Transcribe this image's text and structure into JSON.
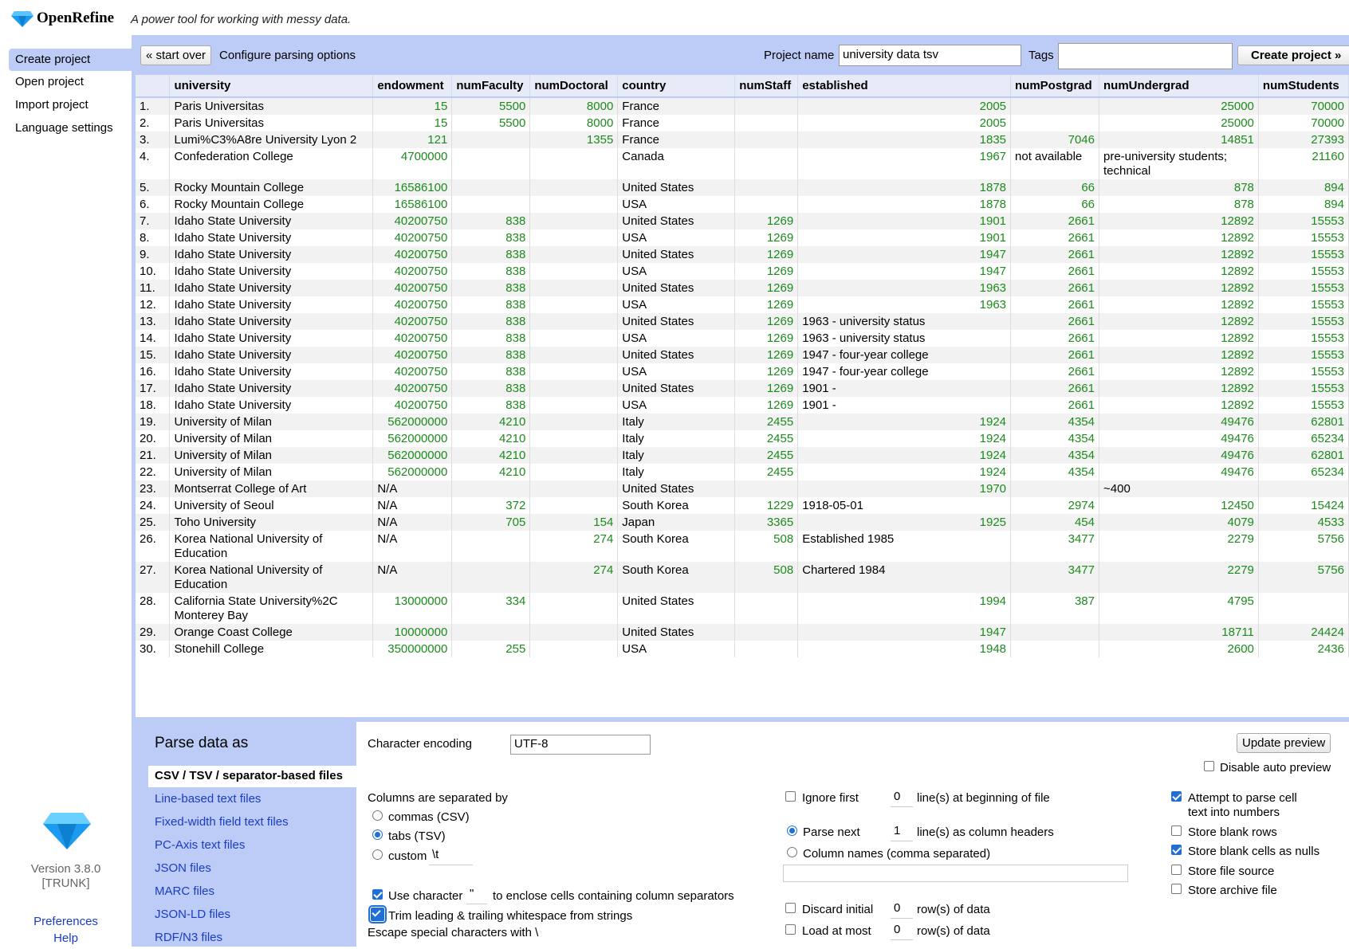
{
  "app": {
    "name": "OpenRefine",
    "tagline": "A power tool for working with messy data."
  },
  "nav": {
    "items": [
      "Create project",
      "Open project",
      "Import project",
      "Language settings"
    ],
    "version": "Version 3.8.0",
    "trunk": "[TRUNK]",
    "preferences": "Preferences",
    "help": "Help"
  },
  "toolbar": {
    "start_over": "« start over",
    "configure": "Configure parsing options",
    "project_name_label": "Project name",
    "project_name_value": "university data tsv",
    "tags_label": "Tags",
    "tags_value": "",
    "create_project": "Create project »"
  },
  "table": {
    "columns": [
      "",
      "university",
      "endowment",
      "numFaculty",
      "numDoctoral",
      "country",
      "numStaff",
      "established",
      "numPostgrad",
      "numUndergrad",
      "numStudents"
    ],
    "rows": [
      [
        "1.",
        "Paris Universitas",
        "15",
        "5500",
        "8000",
        "France",
        "",
        "2005",
        "",
        "25000",
        "70000"
      ],
      [
        "2.",
        "Paris Universitas",
        "15",
        "5500",
        "8000",
        "France",
        "",
        "2005",
        "",
        "25000",
        "70000"
      ],
      [
        "3.",
        "Lumi%C3%A8re University Lyon 2",
        "121",
        "",
        "1355",
        "France",
        "",
        "1835",
        "7046",
        "14851",
        "27393"
      ],
      [
        "4.",
        "Confederation College",
        "4700000",
        "",
        "",
        "Canada",
        "",
        "1967",
        "not available",
        "pre-university students; technical",
        "21160"
      ],
      [
        "5.",
        "Rocky Mountain College",
        "16586100",
        "",
        "",
        "United States",
        "",
        "1878",
        "66",
        "878",
        "894"
      ],
      [
        "6.",
        "Rocky Mountain College",
        "16586100",
        "",
        "",
        "USA",
        "",
        "1878",
        "66",
        "878",
        "894"
      ],
      [
        "7.",
        "Idaho State University",
        "40200750",
        "838",
        "",
        "United States",
        "1269",
        "1901",
        "2661",
        "12892",
        "15553"
      ],
      [
        "8.",
        "Idaho State University",
        "40200750",
        "838",
        "",
        "USA",
        "1269",
        "1901",
        "2661",
        "12892",
        "15553"
      ],
      [
        "9.",
        "Idaho State University",
        "40200750",
        "838",
        "",
        "United States",
        "1269",
        "1947",
        "2661",
        "12892",
        "15553"
      ],
      [
        "10.",
        "Idaho State University",
        "40200750",
        "838",
        "",
        "USA",
        "1269",
        "1947",
        "2661",
        "12892",
        "15553"
      ],
      [
        "11.",
        "Idaho State University",
        "40200750",
        "838",
        "",
        "United States",
        "1269",
        "1963",
        "2661",
        "12892",
        "15553"
      ],
      [
        "12.",
        "Idaho State University",
        "40200750",
        "838",
        "",
        "USA",
        "1269",
        "1963",
        "2661",
        "12892",
        "15553"
      ],
      [
        "13.",
        "Idaho State University",
        "40200750",
        "838",
        "",
        "United States",
        "1269",
        "1963 - university status",
        "2661",
        "12892",
        "15553"
      ],
      [
        "14.",
        "Idaho State University",
        "40200750",
        "838",
        "",
        "USA",
        "1269",
        "1963 - university status",
        "2661",
        "12892",
        "15553"
      ],
      [
        "15.",
        "Idaho State University",
        "40200750",
        "838",
        "",
        "United States",
        "1269",
        "1947 - four-year college",
        "2661",
        "12892",
        "15553"
      ],
      [
        "16.",
        "Idaho State University",
        "40200750",
        "838",
        "",
        "USA",
        "1269",
        "1947 - four-year college",
        "2661",
        "12892",
        "15553"
      ],
      [
        "17.",
        "Idaho State University",
        "40200750",
        "838",
        "",
        "United States",
        "1269",
        "1901 -",
        "2661",
        "12892",
        "15553"
      ],
      [
        "18.",
        "Idaho State University",
        "40200750",
        "838",
        "",
        "USA",
        "1269",
        "1901 -",
        "2661",
        "12892",
        "15553"
      ],
      [
        "19.",
        "University of Milan",
        "562000000",
        "4210",
        "",
        "Italy",
        "2455",
        "1924",
        "4354",
        "49476",
        "62801"
      ],
      [
        "20.",
        "University of Milan",
        "562000000",
        "4210",
        "",
        "Italy",
        "2455",
        "1924",
        "4354",
        "49476",
        "65234"
      ],
      [
        "21.",
        "University of Milan",
        "562000000",
        "4210",
        "",
        "Italy",
        "2455",
        "1924",
        "4354",
        "49476",
        "62801"
      ],
      [
        "22.",
        "University of Milan",
        "562000000",
        "4210",
        "",
        "Italy",
        "2455",
        "1924",
        "4354",
        "49476",
        "65234"
      ],
      [
        "23.",
        "Montserrat College of Art",
        "N/A",
        "",
        "",
        "United States",
        "",
        "1970",
        "",
        "~400",
        ""
      ],
      [
        "24.",
        "University of Seoul",
        "N/A",
        "372",
        "",
        "South Korea",
        "1229",
        "1918-05-01",
        "2974",
        "12450",
        "15424"
      ],
      [
        "25.",
        "Toho University",
        "N/A",
        "705",
        "154",
        "Japan",
        "3365",
        "1925",
        "454",
        "4079",
        "4533"
      ],
      [
        "26.",
        "Korea National University of Education",
        "N/A",
        "",
        "274",
        "South Korea",
        "508",
        "Established 1985",
        "3477",
        "2279",
        "5756"
      ],
      [
        "27.",
        "Korea National University of Education",
        "N/A",
        "",
        "274",
        "South Korea",
        "508",
        "Chartered 1984",
        "3477",
        "2279",
        "5756"
      ],
      [
        "28.",
        "California State University%2C Monterey Bay",
        "13000000",
        "334",
        "",
        "United States",
        "",
        "1994",
        "387",
        "4795",
        ""
      ],
      [
        "29.",
        "Orange Coast College",
        "10000000",
        "",
        "",
        "United States",
        "",
        "1947",
        "",
        "18711",
        "24424"
      ],
      [
        "30.",
        "Stonehill College",
        "350000000",
        "255",
        "",
        "USA",
        "",
        "1948",
        "",
        "2600",
        "2436"
      ]
    ]
  },
  "parse": {
    "title": "Parse data as",
    "formats": [
      "CSV / TSV / separator-based files",
      "Line-based text files",
      "Fixed-width field text files",
      "PC-Axis text files",
      "JSON files",
      "MARC files",
      "JSON-LD files",
      "RDF/N3 files"
    ],
    "char_encoding_label": "Character encoding",
    "char_encoding_value": "UTF-8",
    "update_preview": "Update preview",
    "disable_auto_preview": "Disable auto preview",
    "columns_sep_label": "Columns are separated by",
    "sep_commas": "commas (CSV)",
    "sep_tabs": "tabs (TSV)",
    "sep_custom": "custom",
    "custom_value": "\\t",
    "use_char_a": "Use character",
    "quote_char": "\"",
    "use_char_b": "to enclose cells containing column separators",
    "trim": "Trim leading & trailing whitespace from strings",
    "escape": "Escape special characters with \\",
    "ignore_first": "Ignore first",
    "ignore_value": "0",
    "ignore_suffix": "line(s) at beginning of file",
    "parse_next": "Parse next",
    "parse_next_value": "1",
    "parse_next_suffix": "line(s) as column headers",
    "col_names": "Column names (comma separated)",
    "col_names_value": "",
    "discard": "Discard initial",
    "discard_value": "0",
    "discard_suffix": "row(s) of data",
    "load_most": "Load at most",
    "load_value": "0",
    "load_suffix": "row(s) of data",
    "attempt_parse": "Attempt to parse cell",
    "attempt_parse2": "text into numbers",
    "store_blank_rows": "Store blank rows",
    "store_blank_nulls": "Store blank cells as nulls",
    "store_file_source": "Store file source",
    "store_archive": "Store archive file"
  },
  "colors": {
    "accent": "#bcccf6",
    "number": "#1d8a1d",
    "link": "#1a3cc4",
    "check": "#1f6fd6"
  }
}
